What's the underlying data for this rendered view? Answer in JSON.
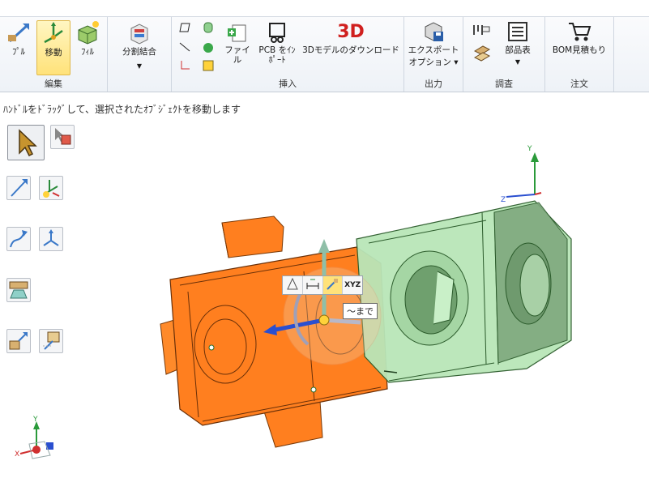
{
  "ribbon": {
    "edit": {
      "label": "編集",
      "pull": "ﾌﾟﾙ",
      "move": "移動",
      "fill": "ﾌｨﾙ"
    },
    "combine": {
      "label": "分割結合"
    },
    "insert": {
      "label": "挿入",
      "file": "ファイル",
      "pcb": "PCB をｲﾝﾎﾟｰﾄ",
      "model3d": "3Dモデルのダウンロード",
      "badge3d": "3D"
    },
    "output": {
      "label": "出力",
      "export_line1": "エクスポート",
      "export_line2": "オプション ▾"
    },
    "survey": {
      "label": "調査",
      "parts": "部品表"
    },
    "order": {
      "label": "注文",
      "bom": "BOM見積もり"
    }
  },
  "status_text": "ﾊﾝﾄﾞﾙをﾄﾞﾗｯｸﾞして、選択されたｵﾌﾞｼﾞｪｸﾄを移動します",
  "minibar": {
    "xyz": "XYZ"
  },
  "tooltip": "〜まで",
  "axes": {
    "y": "Y",
    "x": "X",
    "z": "Z"
  },
  "colors": {
    "orange": "#ff7f1f",
    "green": "#b8e6b8",
    "accent": "#1f5fd0"
  }
}
